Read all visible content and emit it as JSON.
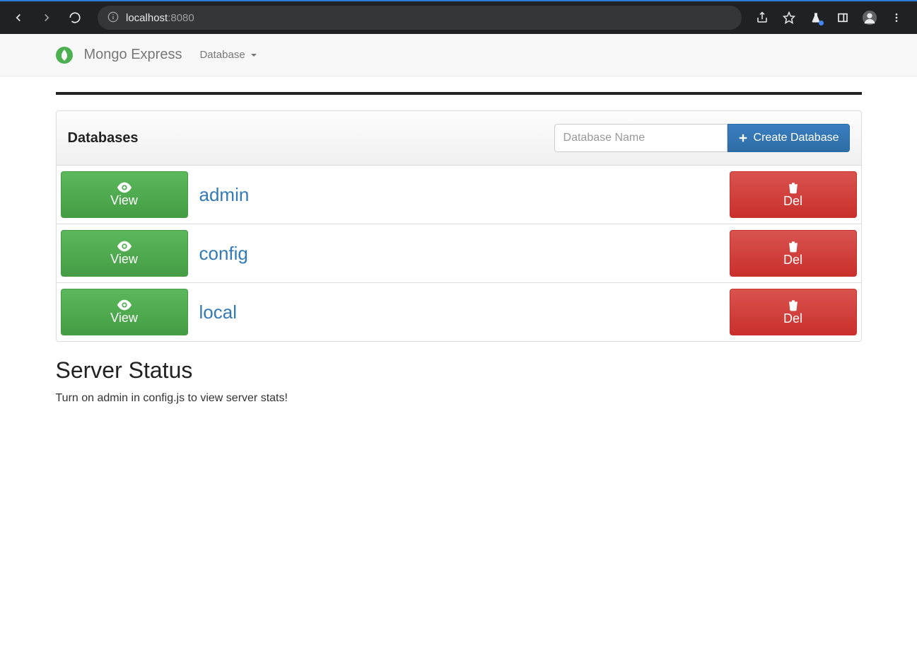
{
  "browser": {
    "url_host": "localhost",
    "url_port": ":8080"
  },
  "nav": {
    "brand": "Mongo Express",
    "menu_database": "Database"
  },
  "panel": {
    "title": "Databases",
    "input_placeholder": "Database Name",
    "create_label": "Create Database",
    "view_label": "View",
    "del_label": "Del",
    "databases": [
      {
        "name": "admin"
      },
      {
        "name": "config"
      },
      {
        "name": "local"
      }
    ]
  },
  "status": {
    "heading": "Server Status",
    "message": "Turn on admin in config.js to view server stats!"
  }
}
